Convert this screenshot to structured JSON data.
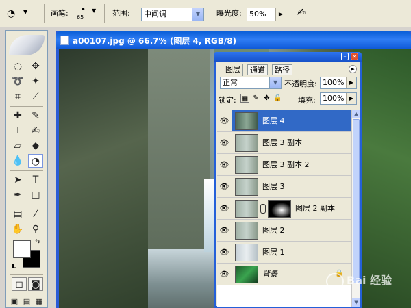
{
  "options_bar": {
    "brush_label": "画笔:",
    "brush_size": "65",
    "range_label": "范围:",
    "range_value": "中间调",
    "exposure_label": "曝光度:",
    "exposure_value": "50%"
  },
  "image_window": {
    "title": "a00107.jpg @ 66.7% (图层 4, RGB/8)"
  },
  "layers_panel": {
    "tabs": [
      "图层",
      "通道",
      "路径"
    ],
    "active_tab": "图层",
    "blend_mode": "正常",
    "opacity_label": "不透明度:",
    "opacity_value": "100%",
    "lock_label": "锁定:",
    "fill_label": "填充:",
    "fill_value": "100%",
    "layers": [
      {
        "name": "图层 4",
        "visible": true,
        "selected": true
      },
      {
        "name": "图层 3 副本",
        "visible": true
      },
      {
        "name": "图层 3 副本 2",
        "visible": true
      },
      {
        "name": "图层 3",
        "visible": true
      },
      {
        "name": "图层 2 副本",
        "visible": true,
        "has_mask": true
      },
      {
        "name": "图层 2",
        "visible": true
      },
      {
        "name": "图层 1",
        "visible": true
      },
      {
        "name": "背景",
        "visible": true,
        "locked": true
      }
    ]
  },
  "watermark": {
    "text": "Bai 经验"
  }
}
